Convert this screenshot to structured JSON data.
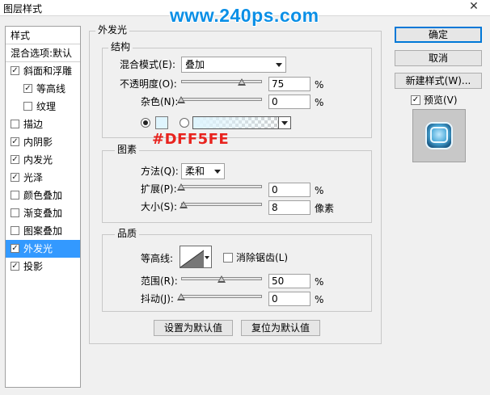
{
  "window": {
    "title": "图层样式",
    "close_glyph": "✕",
    "watermark": "www.240ps.com"
  },
  "sidebar": {
    "header": "样式",
    "blend_options": "混合选项:默认",
    "items": [
      {
        "label": "斜面和浮雕",
        "checked": true
      },
      {
        "label": "等高线",
        "checked": true,
        "indent": true
      },
      {
        "label": "纹理",
        "checked": false,
        "indent": true
      },
      {
        "label": "描边",
        "checked": false
      },
      {
        "label": "内阴影",
        "checked": true
      },
      {
        "label": "内发光",
        "checked": true
      },
      {
        "label": "光泽",
        "checked": true
      },
      {
        "label": "颜色叠加",
        "checked": false
      },
      {
        "label": "渐变叠加",
        "checked": false
      },
      {
        "label": "图案叠加",
        "checked": false
      },
      {
        "label": "外发光",
        "checked": true,
        "selected": true
      },
      {
        "label": "投影",
        "checked": true
      }
    ]
  },
  "outer_glow": {
    "section_title": "外发光",
    "structure": {
      "title": "结构",
      "blend_mode_label": "混合模式(E):",
      "blend_mode_value": "叠加",
      "opacity_label": "不透明度(O):",
      "opacity_value": "75",
      "noise_label": "杂色(N):",
      "noise_value": "0",
      "percent": "%",
      "color_hex_annotation": "#DFF5FE",
      "glow_color": "#dff5fe",
      "opacity_fraction": 0.75,
      "noise_fraction": 0
    },
    "elements": {
      "title": "图素",
      "technique_label": "方法(Q):",
      "technique_value": "柔和",
      "spread_label": "扩展(P):",
      "spread_value": "0",
      "size_label": "大小(S):",
      "size_value": "8",
      "size_unit": "像素",
      "percent": "%",
      "spread_fraction": 0,
      "size_fraction": 0.032
    },
    "quality": {
      "title": "品质",
      "contour_label": "等高线:",
      "antialias_label": "消除锯齿(L)",
      "antialias_checked": false,
      "range_label": "范围(R):",
      "range_value": "50",
      "jitter_label": "抖动(J):",
      "jitter_value": "0",
      "percent": "%",
      "range_fraction": 0.5,
      "jitter_fraction": 0
    },
    "make_default": "设置为默认值",
    "reset_default": "复位为默认值"
  },
  "right_panel": {
    "ok": "确定",
    "cancel": "取消",
    "new_style": "新建样式(W)...",
    "preview_label": "预览(V)",
    "preview_checked": true
  },
  "colors": {
    "selection": "#3399ff",
    "watermark": "#0a8fe6",
    "annotation": "#e8231e"
  }
}
